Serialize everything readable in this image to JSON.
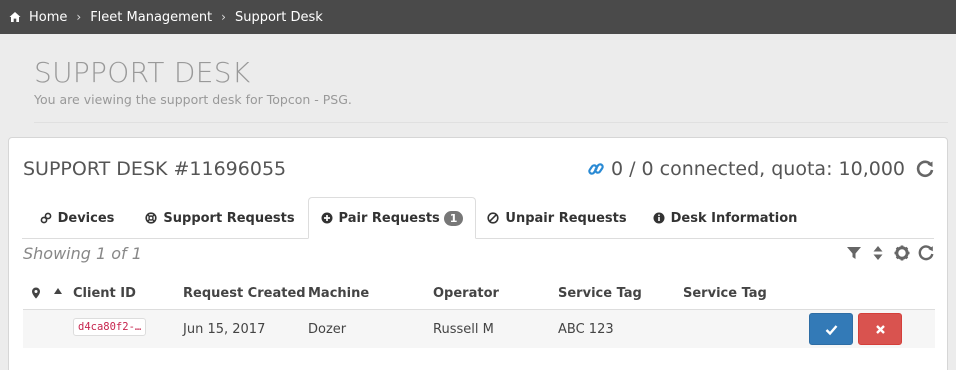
{
  "breadcrumb": {
    "items": [
      "Home",
      "Fleet Management",
      "Support Desk"
    ]
  },
  "header": {
    "title": "SUPPORT DESK",
    "subtitle": "You are viewing the support desk for Topcon - PSG."
  },
  "panel": {
    "desk_title": "SUPPORT DESK #11696055",
    "connection_status": "0 / 0 connected, quota: 10,000"
  },
  "tabs": [
    {
      "label": "Devices",
      "icon": "link-icon"
    },
    {
      "label": "Support Requests",
      "icon": "lifebuoy-icon"
    },
    {
      "label": "Pair Requests",
      "icon": "plus-circle-icon",
      "badge": "1",
      "active": true
    },
    {
      "label": "Unpair Requests",
      "icon": "ban-icon"
    },
    {
      "label": "Desk Information",
      "icon": "info-circle-icon"
    }
  ],
  "list": {
    "showing": "Showing 1 of 1"
  },
  "table": {
    "headers": [
      "Client ID",
      "Request Created",
      "Machine",
      "Operator",
      "Service Tag",
      "Service Tag"
    ],
    "rows": [
      {
        "client_id": "d4ca80f2-…",
        "request_created": "Jun 15, 2017",
        "machine": "Dozer",
        "operator": "Russell M",
        "service_tag": "ABC 123",
        "service_tag_2": ""
      }
    ]
  },
  "colors": {
    "topbar": "#4a4a4a",
    "primary": "#337ab7",
    "danger": "#d9534f",
    "link": "#2a8ad4"
  }
}
